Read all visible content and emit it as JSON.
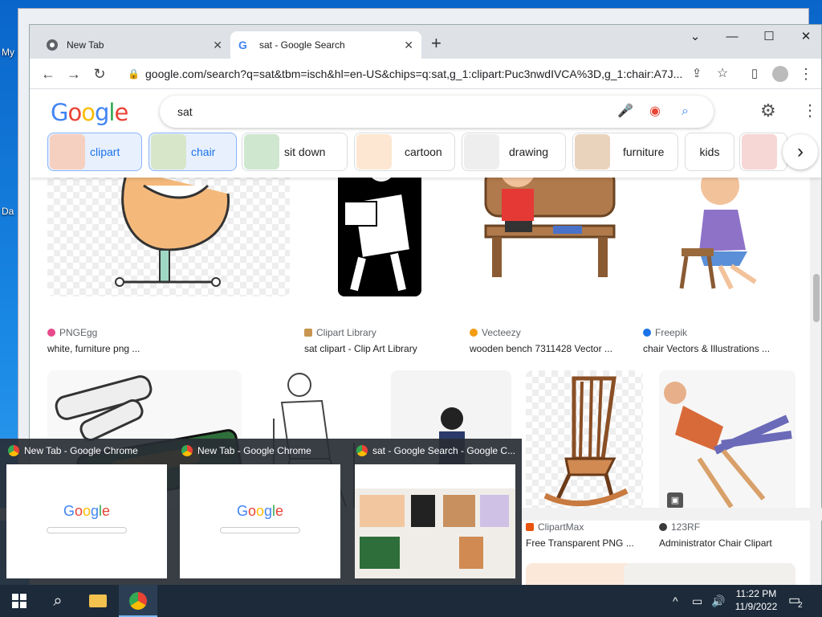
{
  "desktop": {
    "labels": [
      "My",
      "Da"
    ]
  },
  "browser": {
    "tabs": [
      {
        "title": "New Tab"
      },
      {
        "title": "sat - Google Search"
      }
    ],
    "url": "google.com/search?q=sat&tbm=isch&hl=en-US&chips=q:sat,g_1:clipart:Puc3nwdIVCA%3D,g_1:chair:A7J..."
  },
  "google": {
    "logo": "Google",
    "query": "sat",
    "chips": [
      "clipart",
      "chair",
      "sit down",
      "cartoon",
      "drawing",
      "furniture",
      "kids"
    ],
    "results_row1": [
      {
        "source": "PNGEgg",
        "title": "white, furniture png ..."
      },
      {
        "source": "Clipart Library",
        "title": "sat clipart - Clip Art Library"
      },
      {
        "source": "Vecteezy",
        "title": "wooden bench 7311428 Vector ..."
      },
      {
        "source": "Freepik",
        "title": "chair Vectors & Illustrations ..."
      }
    ],
    "results_row2": [
      {
        "source": "ClipartMax",
        "title": "Free Transparent PNG ..."
      },
      {
        "source": "123RF",
        "title": "Administrator Chair Clipart"
      }
    ]
  },
  "taskbar": {
    "previews": [
      {
        "title": "New Tab - Google Chrome"
      },
      {
        "title": "New Tab - Google Chrome"
      },
      {
        "title": "sat - Google Search - Google C..."
      }
    ],
    "time": "11:22 PM",
    "date": "11/9/2022",
    "notifications": "2"
  }
}
